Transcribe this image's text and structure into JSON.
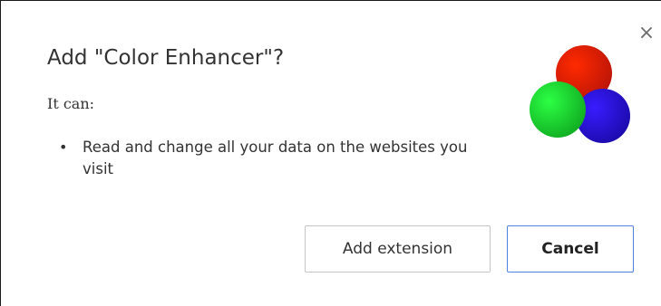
{
  "dialog": {
    "title": "Add \"Color Enhancer\"?",
    "subtitle": "It can:",
    "permissions": [
      "Read and change all your data on the websites you visit"
    ],
    "close_glyph": "×",
    "bullet_glyph": "•",
    "icon": {
      "name": "color-enhancer-icon",
      "colors": {
        "red": "#e81e0a",
        "green": "#15d62a",
        "blue": "#2310d6"
      }
    }
  },
  "buttons": {
    "add_label": "Add extension",
    "cancel_label": "Cancel"
  },
  "colors": {
    "cancel_border": "#4c82e0",
    "button_border": "#c5c5c5",
    "text": "#333333"
  }
}
